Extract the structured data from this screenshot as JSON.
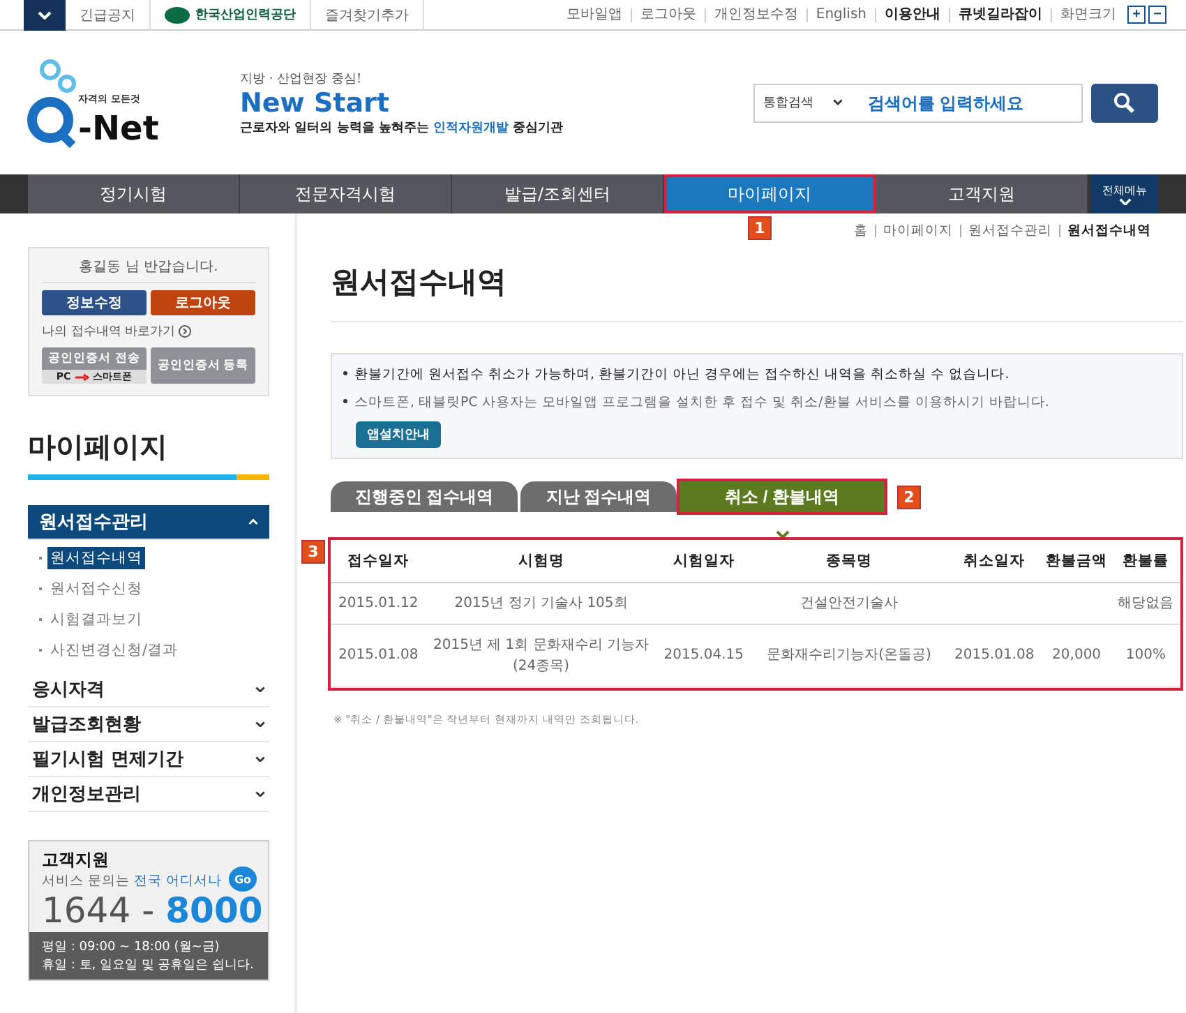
{
  "top_bar": {
    "left_links": [
      "긴급공지",
      "한국산업인력공단",
      "즐겨찾기추가"
    ],
    "right_links": [
      {
        "label": "모바일앱",
        "bold": false
      },
      {
        "label": "로그아웃",
        "bold": false
      },
      {
        "label": "개인정보수정",
        "bold": false
      },
      {
        "label": "English",
        "bold": false
      },
      {
        "label": "이용안내",
        "bold": true
      },
      {
        "label": "큐넷길라잡이",
        "bold": true
      }
    ],
    "font_size_label": "화면크기",
    "zoom_buttons": [
      "+",
      "−"
    ]
  },
  "header": {
    "logo": {
      "tagline": "자격의 모든것",
      "name": "-Net"
    },
    "slogan": {
      "kicker": "지방 · 산업현장 중심!",
      "title": "New Start",
      "line_before": "근로자와 일터의 능력을 높혀주는 ",
      "line_highlight": "인적자원개발",
      "line_after": " 중심기관"
    },
    "search": {
      "scope": "통합검색",
      "placeholder": "검색어를 입력하세요"
    }
  },
  "nav": {
    "items": [
      {
        "label": "정기시험",
        "selected": false
      },
      {
        "label": "전문자격시험",
        "selected": false
      },
      {
        "label": "발급/조회센터",
        "selected": false
      },
      {
        "label": "마이페이지",
        "selected": true,
        "annotation": "1"
      },
      {
        "label": "고객지원",
        "selected": false
      }
    ],
    "all_menu": "전체메뉴"
  },
  "sidebar": {
    "welcome": "홍길동 님 반갑습니다.",
    "buttons": [
      {
        "label": "정보수정",
        "kind": "primary"
      },
      {
        "label": "로그아웃",
        "kind": "danger"
      }
    ],
    "shortcut": "나의 접수내역 바로가기",
    "cert_send": {
      "label": "공인인증서 전송",
      "from": "PC",
      "to": "스마트폰"
    },
    "cert_register": "공인인증서 등록",
    "section_title": "마이페이지",
    "menu": [
      {
        "label": "원서접수관리",
        "expanded": true,
        "children": [
          {
            "label": "원서접수내역",
            "selected": true
          },
          {
            "label": "원서접수신청",
            "selected": false
          },
          {
            "label": "시험결과보기",
            "selected": false
          },
          {
            "label": "사진변경신청/결과",
            "selected": false
          }
        ]
      },
      {
        "label": "응시자격",
        "expanded": false
      },
      {
        "label": "발급조회현황",
        "expanded": false
      },
      {
        "label": "필기시험 면제기간",
        "expanded": false
      },
      {
        "label": "개인정보관리",
        "expanded": false
      }
    ],
    "support": {
      "title": "고객지원",
      "subtitle_before": "서비스 문의는 ",
      "subtitle_highlight": "전국 어디서나",
      "go": "Go",
      "phone_prefix": "1644",
      "phone_separator": "-",
      "phone_suffix": "8000",
      "hours": [
        "평일 : 09:00 ~ 18:00 (월~금)",
        "휴일 : 토, 일요일 및 공휴일은 쉽니다."
      ]
    }
  },
  "content": {
    "breadcrumb": [
      {
        "label": "홈",
        "current": false
      },
      {
        "label": "마이페이지",
        "current": false
      },
      {
        "label": "원서접수관리",
        "current": false
      },
      {
        "label": "원서접수내역",
        "current": true
      }
    ],
    "title": "원서접수내역",
    "notice": {
      "lines": [
        {
          "text": "환불기간에 원서접수 취소가 가능하며, 환불기간이 아닌 경우에는 접수하신 내역을 취소하실 수 없습니다.",
          "emphasis": true
        },
        {
          "text": "스마트폰, 태블릿PC 사용자는 모바일앱 프로그램을 설치한 후 접수 및 취소/환불 서비스를 이용하시기 바랍니다.",
          "emphasis": false
        }
      ],
      "button": "앱설치안내"
    },
    "tabs": [
      {
        "label": "진행중인 접수내역",
        "selected": false
      },
      {
        "label": "지난 접수내역",
        "selected": false
      },
      {
        "label": "취소 / 환불내역",
        "selected": true,
        "annotation": "2"
      }
    ],
    "table": {
      "annotation": "3",
      "columns": [
        "접수일자",
        "시험명",
        "시험일자",
        "종목명",
        "취소일자",
        "환불금액",
        "환불률"
      ],
      "rows": [
        [
          "2015.01.12",
          "2015년 정기 기술사 105회",
          "",
          "건설안전기술사",
          "",
          "",
          "해당없음"
        ],
        [
          "2015.01.08",
          "2015년 제 1회 문화재수리 기능자(24종목)",
          "2015.04.15",
          "문화재수리기능자(온돌공)",
          "2015.01.08",
          "20,000",
          "100%"
        ]
      ]
    },
    "footnote": "※ \"취소 / 환불내역\"은 작년부터 현재까지 내역만 조회됩니다."
  }
}
